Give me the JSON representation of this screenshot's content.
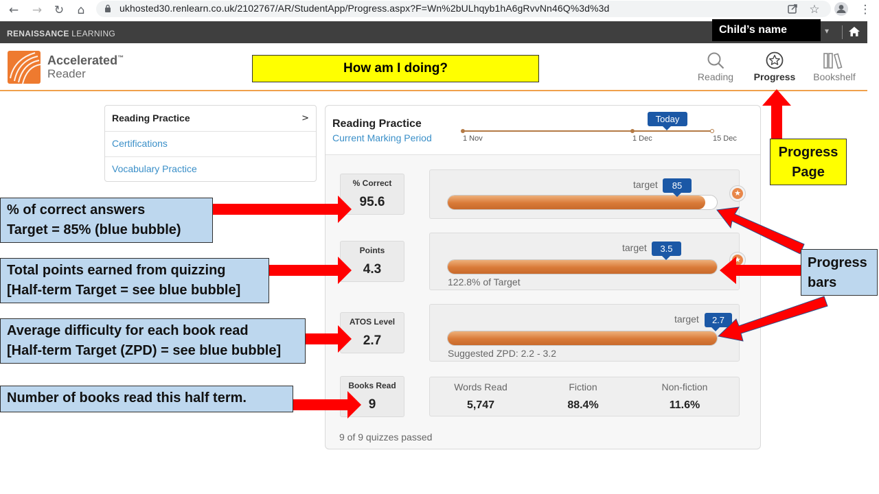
{
  "browser": {
    "url": "ukhosted30.renlearn.co.uk/2102767/AR/StudentApp/Progress.aspx?F=Wn%2bULhqyb1hA6gRvvNn46Q%3d%3d",
    "icons": [
      "back-arrow-icon",
      "forward-arrow-icon",
      "reload-icon",
      "home-icon",
      "lock-icon",
      "share-icon",
      "star-icon",
      "profile-icon",
      "more-vertical-icon"
    ]
  },
  "renaissance": {
    "logo_bold": "RENAISSANCE",
    "logo_rest": " LEARNING",
    "child_name": "Child’s name"
  },
  "header": {
    "logo_line1": "Accelerated",
    "logo_tm": "™",
    "logo_line2": "Reader",
    "title": "How am I doing?",
    "tabs": [
      {
        "label": "Reading",
        "icon": "search-icon",
        "active": false
      },
      {
        "label": "Progress",
        "icon": "star-circle-icon",
        "active": true
      },
      {
        "label": "Bookshelf",
        "icon": "bookshelf-icon",
        "active": false
      }
    ]
  },
  "menu": {
    "items": [
      {
        "label": "Reading Practice",
        "chevron": ">"
      },
      {
        "label": "Certifications"
      },
      {
        "label": "Vocabulary Practice"
      }
    ]
  },
  "panel": {
    "title": "Reading Practice",
    "subtitle": "Current Marking Period",
    "timeline": {
      "labels": [
        "1 Nov",
        "1 Dec",
        "15 Dec"
      ],
      "today": "Today"
    },
    "stats": [
      {
        "label": "% Correct",
        "value": "95.6"
      },
      {
        "label": "Points",
        "value": "4.3"
      },
      {
        "label": "ATOS Level",
        "value": "2.7"
      },
      {
        "label": "Books Read",
        "value": "9"
      }
    ],
    "bars": [
      {
        "target_label": "target",
        "target": "85",
        "fill": 0.956,
        "note": ""
      },
      {
        "target_label": "target",
        "target": "3.5",
        "fill": 1.0,
        "note": "122.8% of Target"
      },
      {
        "target_label": "target",
        "target": "2.7",
        "fill": 1.0,
        "note": "Suggested ZPD: 2.2 - 3.2"
      }
    ],
    "books": {
      "columns": [
        {
          "label": "Words Read",
          "value": "5,747"
        },
        {
          "label": "Fiction",
          "value": "88.4%"
        },
        {
          "label": "Non-fiction",
          "value": "11.6%"
        }
      ]
    },
    "quizzes": "9 of 9 quizzes passed"
  },
  "annotations": {
    "correct": [
      "% of correct answers",
      "Target = 85% (blue bubble)"
    ],
    "points": [
      "Total points earned from quizzing",
      "[Half-term Target = see blue bubble]"
    ],
    "atos": [
      "Average difficulty for each book read",
      "[Half-term Target (ZPD) = see blue bubble]"
    ],
    "books": "Number of books read this half term.",
    "progress_page": [
      "Progress",
      "Page"
    ],
    "progress_bars": [
      "Progress",
      "bars"
    ]
  },
  "colors": {
    "accent_orange": "#ee7a2f",
    "bubble_blue": "#1b58a6",
    "link_blue": "#3a8fc8",
    "annotation_blue": "#bdd7ee",
    "arrow_red": "#ff0000",
    "highlight_yellow": "#ffff00"
  }
}
